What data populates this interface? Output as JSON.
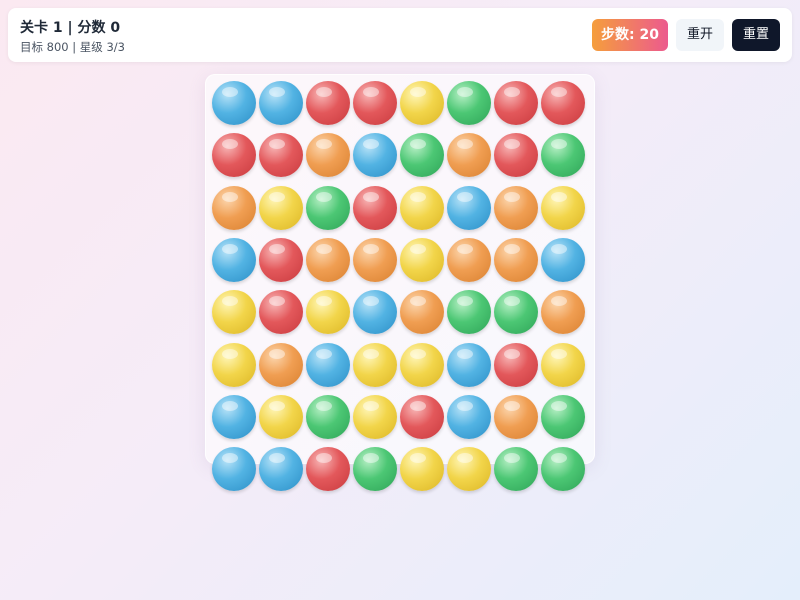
{
  "header": {
    "title": "关卡 1 | 分数 0",
    "subtitle": "目标 800 | 星级 3/3",
    "steps_label": "步数: 20",
    "restart_label": "重开",
    "reset_label": "重置"
  },
  "board": {
    "rows": 8,
    "cols": 8,
    "colors": {
      "blue": "#52b3e3",
      "red": "#e3585b",
      "yellow": "#f2d54a",
      "green": "#4cc774",
      "orange": "#f09e52"
    },
    "grid": [
      [
        "blue",
        "blue",
        "red",
        "red",
        "yellow",
        "green",
        "red",
        "red"
      ],
      [
        "red",
        "red",
        "orange",
        "blue",
        "green",
        "orange",
        "red",
        "green"
      ],
      [
        "orange",
        "yellow",
        "green",
        "red",
        "yellow",
        "blue",
        "orange",
        "yellow"
      ],
      [
        "blue",
        "red",
        "orange",
        "orange",
        "yellow",
        "orange",
        "orange",
        "blue"
      ],
      [
        "yellow",
        "red",
        "yellow",
        "blue",
        "orange",
        "green",
        "green",
        "orange"
      ],
      [
        "yellow",
        "orange",
        "blue",
        "yellow",
        "yellow",
        "blue",
        "red",
        "yellow"
      ],
      [
        "blue",
        "yellow",
        "green",
        "yellow",
        "red",
        "blue",
        "orange",
        "green"
      ],
      [
        "blue",
        "blue",
        "red",
        "green",
        "yellow",
        "yellow",
        "green",
        "green"
      ]
    ]
  }
}
